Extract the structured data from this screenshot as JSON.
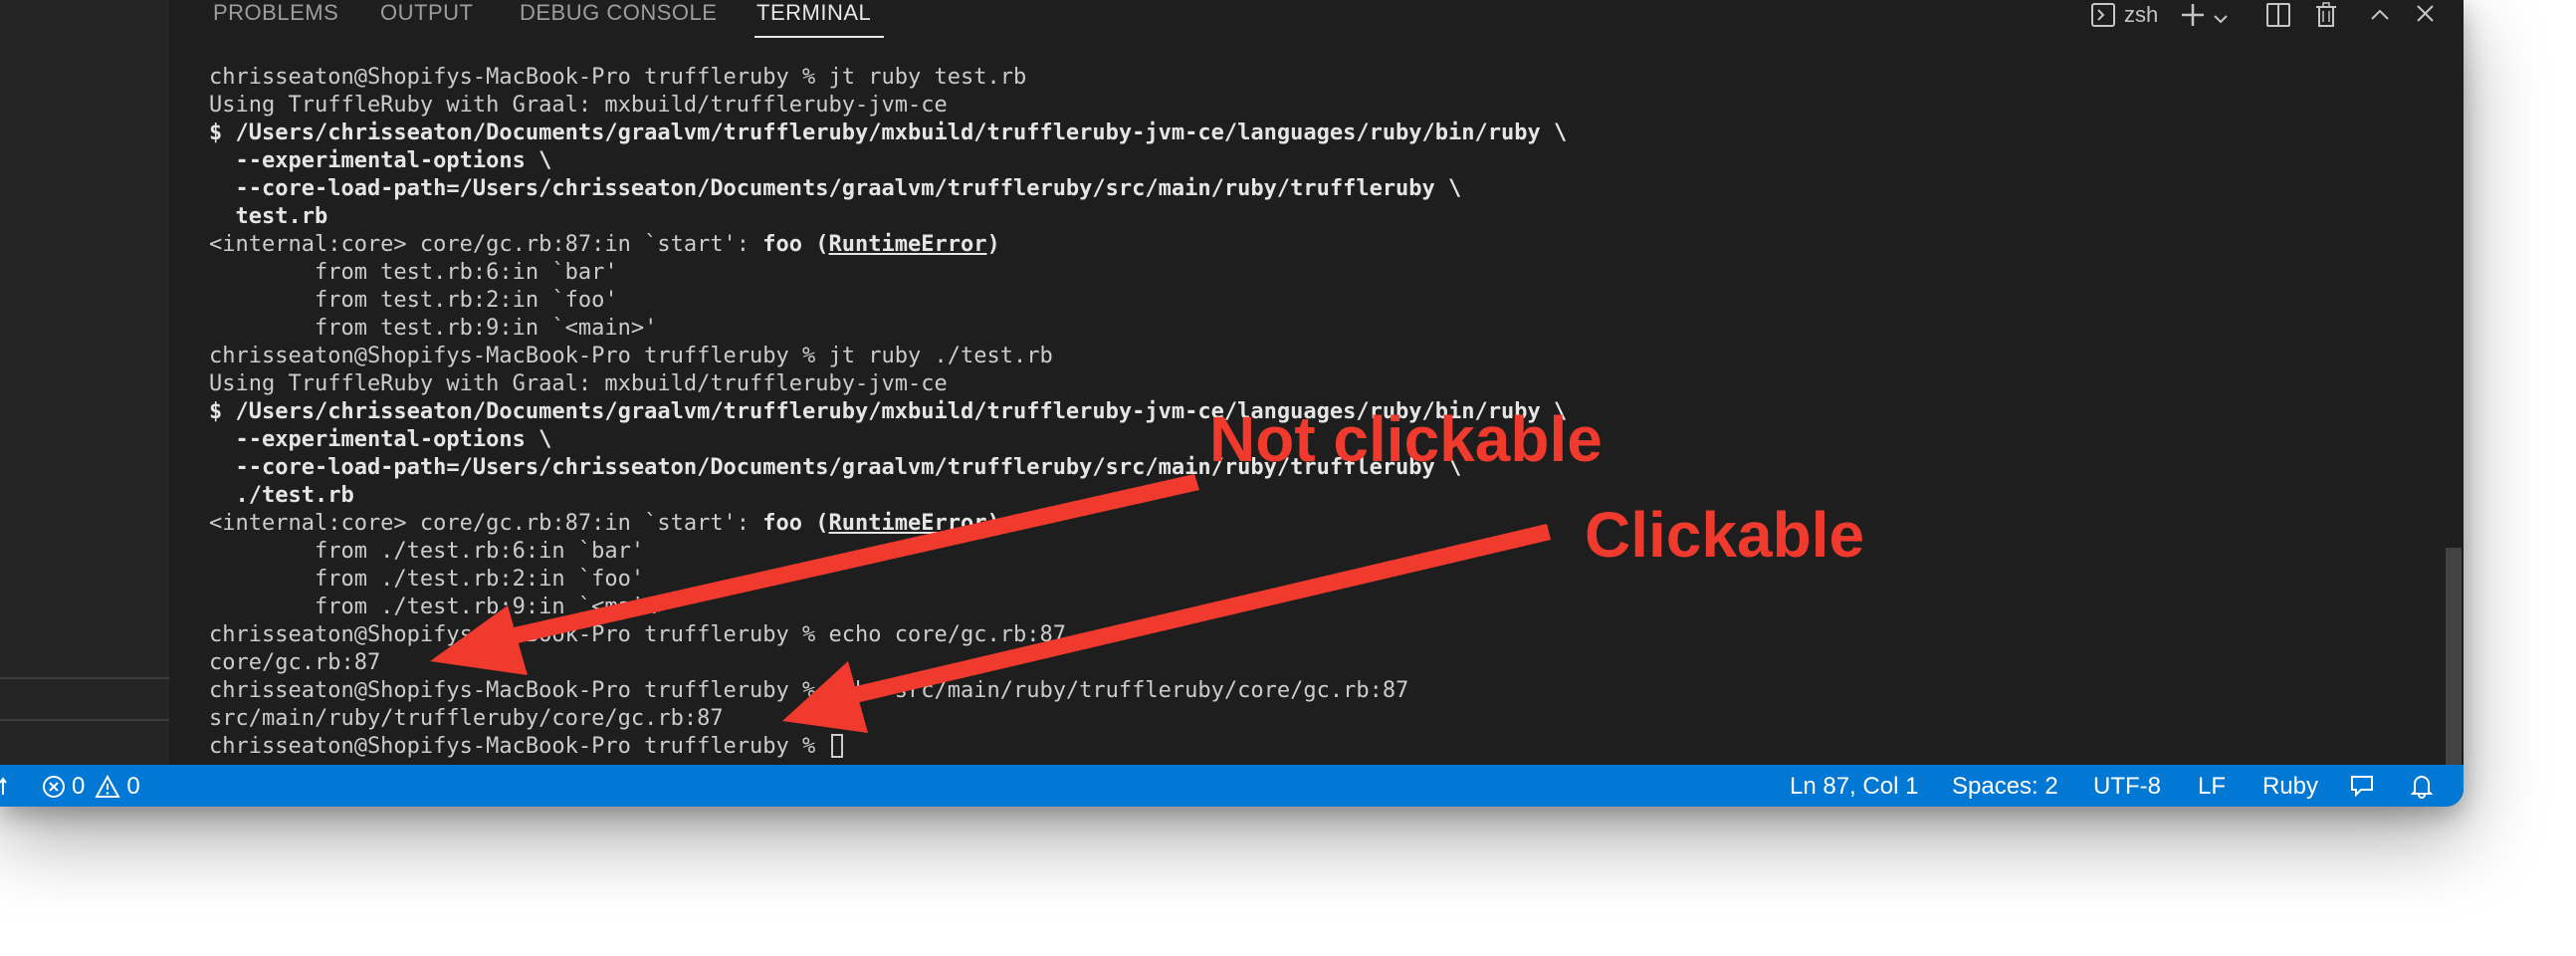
{
  "panel": {
    "tabs": [
      {
        "label": "PROBLEMS",
        "active": false
      },
      {
        "label": "OUTPUT",
        "active": false
      },
      {
        "label": "DEBUG CONSOLE",
        "active": false
      },
      {
        "label": "TERMINAL",
        "active": true
      }
    ],
    "terminal_selector": {
      "label": "zsh",
      "icon": "terminal-icon"
    },
    "toolbar_icons": [
      "add-terminal-icon",
      "chevron-down-icon",
      "split-terminal-icon",
      "trash-icon",
      "maximize-panel-icon",
      "close-icon"
    ]
  },
  "terminal": {
    "lines": [
      [
        {
          "t": "chrisseaton@Shopifys-MacBook-Pro truffleruby % jt ruby test.rb"
        }
      ],
      [
        {
          "t": "Using TruffleRuby with Graal: mxbuild/truffleruby-jvm-ce"
        }
      ],
      [
        {
          "t": "$ /Users/chrisseaton/Documents/graalvm/truffleruby/mxbuild/truffleruby-jvm-ce/languages/ruby/bin/ruby \\",
          "b": true
        }
      ],
      [
        {
          "t": "  --experimental-options \\",
          "b": true
        }
      ],
      [
        {
          "t": "  --core-load-path=/Users/chrisseaton/Documents/graalvm/truffleruby/src/main/ruby/truffleruby \\",
          "b": true
        }
      ],
      [
        {
          "t": "  test.rb",
          "b": true
        }
      ],
      [
        {
          "t": "<internal:core> core/gc.rb:87:in `start': "
        },
        {
          "t": "foo (",
          "b": true
        },
        {
          "t": "RuntimeError",
          "b": true,
          "u": true
        },
        {
          "t": ")",
          "b": true
        }
      ],
      [
        {
          "t": "        from test.rb:6:in `bar'"
        }
      ],
      [
        {
          "t": "        from test.rb:2:in `foo'"
        }
      ],
      [
        {
          "t": "        from test.rb:9:in `<main>'"
        }
      ],
      [
        {
          "t": "chrisseaton@Shopifys-MacBook-Pro truffleruby % jt ruby ./test.rb"
        }
      ],
      [
        {
          "t": "Using TruffleRuby with Graal: mxbuild/truffleruby-jvm-ce"
        }
      ],
      [
        {
          "t": "$ /Users/chrisseaton/Documents/graalvm/truffleruby/mxbuild/truffleruby-jvm-ce/languages/ruby/bin/ruby \\",
          "b": true
        }
      ],
      [
        {
          "t": "  --experimental-options \\",
          "b": true
        }
      ],
      [
        {
          "t": "  --core-load-path=/Users/chrisseaton/Documents/graalvm/truffleruby/src/main/ruby/truffleruby \\",
          "b": true
        }
      ],
      [
        {
          "t": "  ./test.rb",
          "b": true
        }
      ],
      [
        {
          "t": "<internal:core> core/gc.rb:87:in `start': "
        },
        {
          "t": "foo (",
          "b": true
        },
        {
          "t": "RuntimeError",
          "b": true,
          "u": true
        },
        {
          "t": ")",
          "b": true
        }
      ],
      [
        {
          "t": "        from ./test.rb:6:in `bar'"
        }
      ],
      [
        {
          "t": "        from ./test.rb:2:in `foo'"
        }
      ],
      [
        {
          "t": "        from ./test.rb:9:in `<main>'"
        }
      ],
      [
        {
          "t": "chrisseaton@Shopifys-MacBook-Pro truffleruby % echo core/gc.rb:87"
        }
      ],
      [
        {
          "t": "core/gc.rb:87"
        }
      ],
      [
        {
          "t": "chrisseaton@Shopifys-MacBook-Pro truffleruby % echo src/main/ruby/truffleruby/core/gc.rb:87"
        }
      ],
      [
        {
          "t": "src/main/ruby/truffleruby/core/gc.rb:87"
        }
      ],
      [
        {
          "t": "chrisseaton@Shopifys-MacBook-Pro truffleruby % "
        }
      ]
    ]
  },
  "statusbar": {
    "errors": "0",
    "warnings": "0",
    "position": "Ln 87, Col 1",
    "spaces": "Spaces: 2",
    "encoding": "UTF-8",
    "eol": "LF",
    "language": "Ruby",
    "icons": [
      "sync-icon",
      "error-icon",
      "warning-icon",
      "feedback-icon",
      "bell-icon"
    ]
  },
  "annotations": {
    "not_clickable": "Not clickable",
    "clickable": "Clickable",
    "color": "#f03a2e"
  }
}
